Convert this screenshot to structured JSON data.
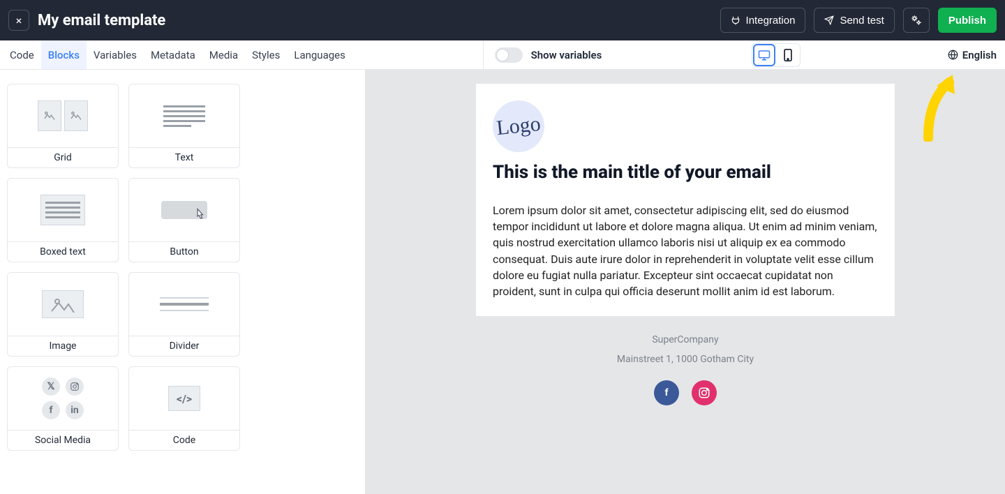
{
  "header": {
    "close": "×",
    "title": "My email template",
    "integration": "Integration",
    "send_test": "Send test",
    "publish": "Publish"
  },
  "tabs": {
    "code": "Code",
    "blocks": "Blocks",
    "variables": "Variables",
    "metadata": "Metadata",
    "media": "Media",
    "styles": "Styles",
    "languages": "Languages",
    "active": "blocks"
  },
  "toolbar": {
    "show_variables": "Show variables",
    "language": "English"
  },
  "blocks": {
    "grid": "Grid",
    "text": "Text",
    "boxed_text": "Boxed text",
    "button": "Button",
    "image": "Image",
    "divider": "Divider",
    "social": "Social Media",
    "code": "Code"
  },
  "email": {
    "logo": "Logo",
    "title": "This is the main title of your email",
    "body": "Lorem ipsum dolor sit amet, consectetur adipiscing elit, sed do eiusmod tempor incididunt ut labore et dolore magna aliqua. Ut enim ad minim veniam, quis nostrud exercitation ullamco laboris nisi ut aliquip ex ea commodo consequat. Duis aute irure dolor in reprehenderit in voluptate velit esse cillum dolore eu fugiat nulla pariatur. Excepteur sint occaecat cupidatat non proident, sunt in culpa qui officia deserunt mollit anim id est laborum.",
    "company": "SuperCompany",
    "address": "Mainstreet 1, 1000 Gotham City"
  }
}
